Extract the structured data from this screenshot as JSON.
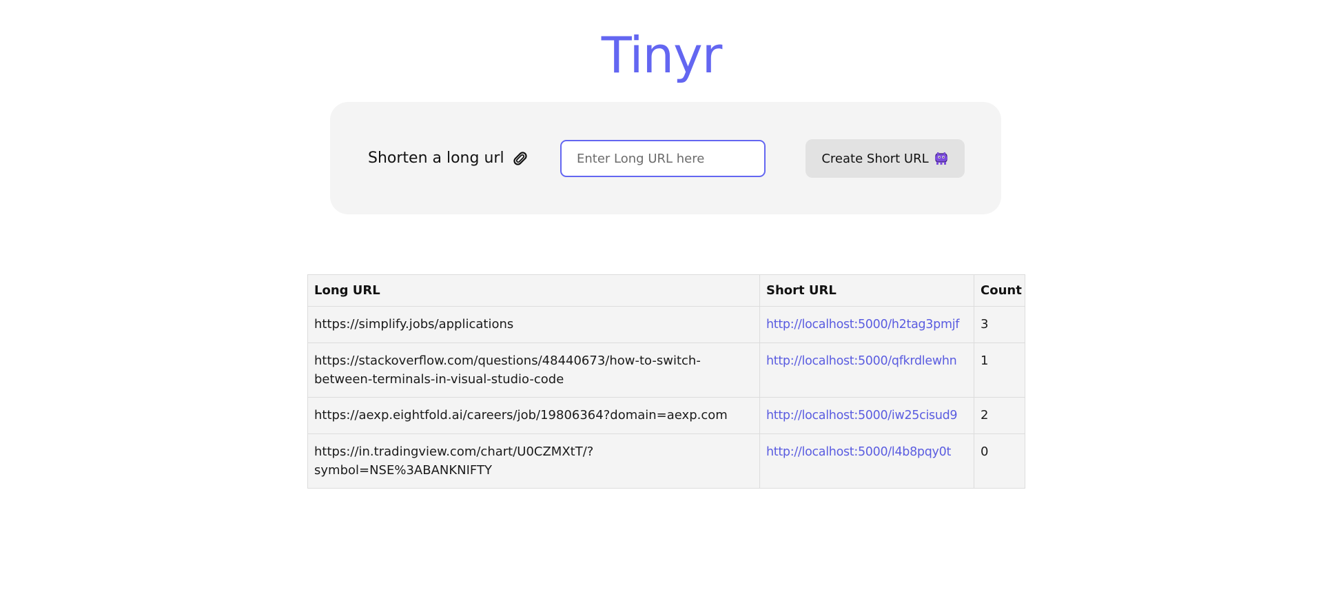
{
  "app": {
    "title": "Tinyr"
  },
  "shorten_form": {
    "label": "Shorten a long url",
    "label_icon": "paperclip-icon",
    "input_value": "",
    "input_placeholder": "Enter Long URL here",
    "button_label": "Create Short URL",
    "button_icon": "alien-monster-icon"
  },
  "table": {
    "headers": {
      "long_url": "Long URL",
      "short_url": "Short URL",
      "count": "Count"
    },
    "rows": [
      {
        "long_url": "https://simplify.jobs/applications",
        "short_url": "http://localhost:5000/h2tag3pmjf",
        "count": "3"
      },
      {
        "long_url": "https://stackoverflow.com/questions/48440673/how-to-switch-between-terminals-in-visual-studio-code",
        "short_url": "http://localhost:5000/qfkrdlewhn",
        "count": "1"
      },
      {
        "long_url": "https://aexp.eightfold.ai/careers/job/19806364?domain=aexp.com",
        "short_url": "http://localhost:5000/iw25cisud9",
        "count": "2"
      },
      {
        "long_url": "https://in.tradingview.com/chart/U0CZMXtT/?symbol=NSE%3ABANKNIFTY",
        "short_url": "http://localhost:5000/l4b8pqy0t",
        "count": "0"
      }
    ]
  },
  "colors": {
    "accent": "#6366f1",
    "panel_background": "#f4f4f4",
    "button_background": "#e2e2e2",
    "link": "#5a5ce0"
  }
}
